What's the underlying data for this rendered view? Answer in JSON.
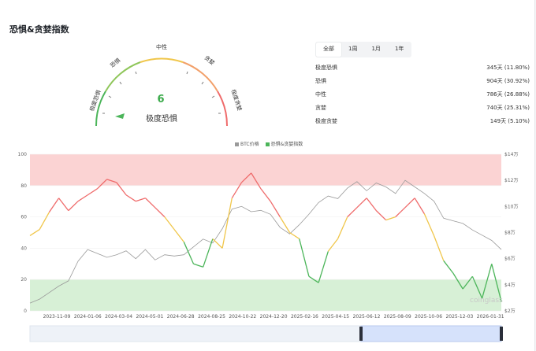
{
  "title": "恐惧&贪婪指数",
  "gauge": {
    "value": "6",
    "label": "极度恐惧",
    "segments": [
      "极度恐惧",
      "恐惧",
      "中性",
      "贪婪",
      "极度贪婪"
    ]
  },
  "tabs": [
    "全部",
    "1周",
    "1月",
    "1年"
  ],
  "stats": [
    {
      "label": "极度恐惧",
      "value": "345天 (11.80%)"
    },
    {
      "label": "恐惧",
      "value": "904天 (30.92%)"
    },
    {
      "label": "中性",
      "value": "786天 (26.88%)"
    },
    {
      "label": "贪婪",
      "value": "740天 (25.31%)"
    },
    {
      "label": "极度贪婪",
      "value": "149天 (5.10%)"
    }
  ],
  "legend": {
    "btc": "BTC价格",
    "fg": "恐惧&贪婪指数"
  },
  "colors": {
    "btc": "#9a9a9a",
    "extreme_fear": "#4cb55a",
    "neutral": "#f0c64a",
    "greed": "#ef6b6b",
    "fear_band": "#d7f0d6",
    "greed_band": "#fbd3d3"
  },
  "watermark": "coinglass",
  "chart_data": {
    "type": "line",
    "x_ticks": [
      "2023-11-09",
      "2024-01-06",
      "2024-03-04",
      "2024-05-01",
      "2024-06-28",
      "2024-08-25",
      "2024-10-22",
      "2024-12-20",
      "2025-02-16",
      "2025-04-15",
      "2025-06-12",
      "2025-08-09",
      "2025-10-06",
      "2025-12-03",
      "2026-01-31"
    ],
    "y_left": {
      "ticks": [
        "0",
        "20",
        "40",
        "60",
        "80",
        "100"
      ],
      "ylim": [
        0,
        100
      ]
    },
    "y_right": {
      "ticks": [
        "$2万",
        "$4万",
        "$6万",
        "$8万",
        "$10万",
        "$12万",
        "$14万"
      ],
      "ylim": [
        2,
        14
      ],
      "unit": "万 USD"
    },
    "bands": [
      {
        "from": 0,
        "to": 20,
        "label": "extreme fear"
      },
      {
        "from": 80,
        "to": 100,
        "label": "extreme greed"
      }
    ],
    "series": [
      {
        "name": "BTC价格",
        "axis": "right",
        "values": [
          2.6,
          2.9,
          3.4,
          3.9,
          4.3,
          5.8,
          6.7,
          6.4,
          6.1,
          6.3,
          6.6,
          6.0,
          6.7,
          5.9,
          6.3,
          6.2,
          6.3,
          6.9,
          7.5,
          7.2,
          8.3,
          9.8,
          10.0,
          9.6,
          9.7,
          9.4,
          8.4,
          7.9,
          8.6,
          9.4,
          10.3,
          10.8,
          10.6,
          11.4,
          11.9,
          11.2,
          11.8,
          11.5,
          11.0,
          12.0,
          11.5,
          11.0,
          10.4,
          9.1,
          8.9,
          8.7,
          8.2,
          7.8,
          7.4,
          6.7
        ]
      },
      {
        "name": "恐惧&贪婪指数",
        "axis": "left",
        "values": [
          48,
          52,
          63,
          72,
          64,
          70,
          74,
          78,
          84,
          82,
          74,
          70,
          72,
          66,
          60,
          52,
          44,
          30,
          28,
          46,
          40,
          72,
          82,
          88,
          78,
          70,
          60,
          50,
          46,
          22,
          18,
          38,
          46,
          60,
          66,
          72,
          64,
          58,
          60,
          66,
          72,
          62,
          48,
          32,
          24,
          14,
          22,
          8,
          30,
          6
        ]
      }
    ]
  }
}
